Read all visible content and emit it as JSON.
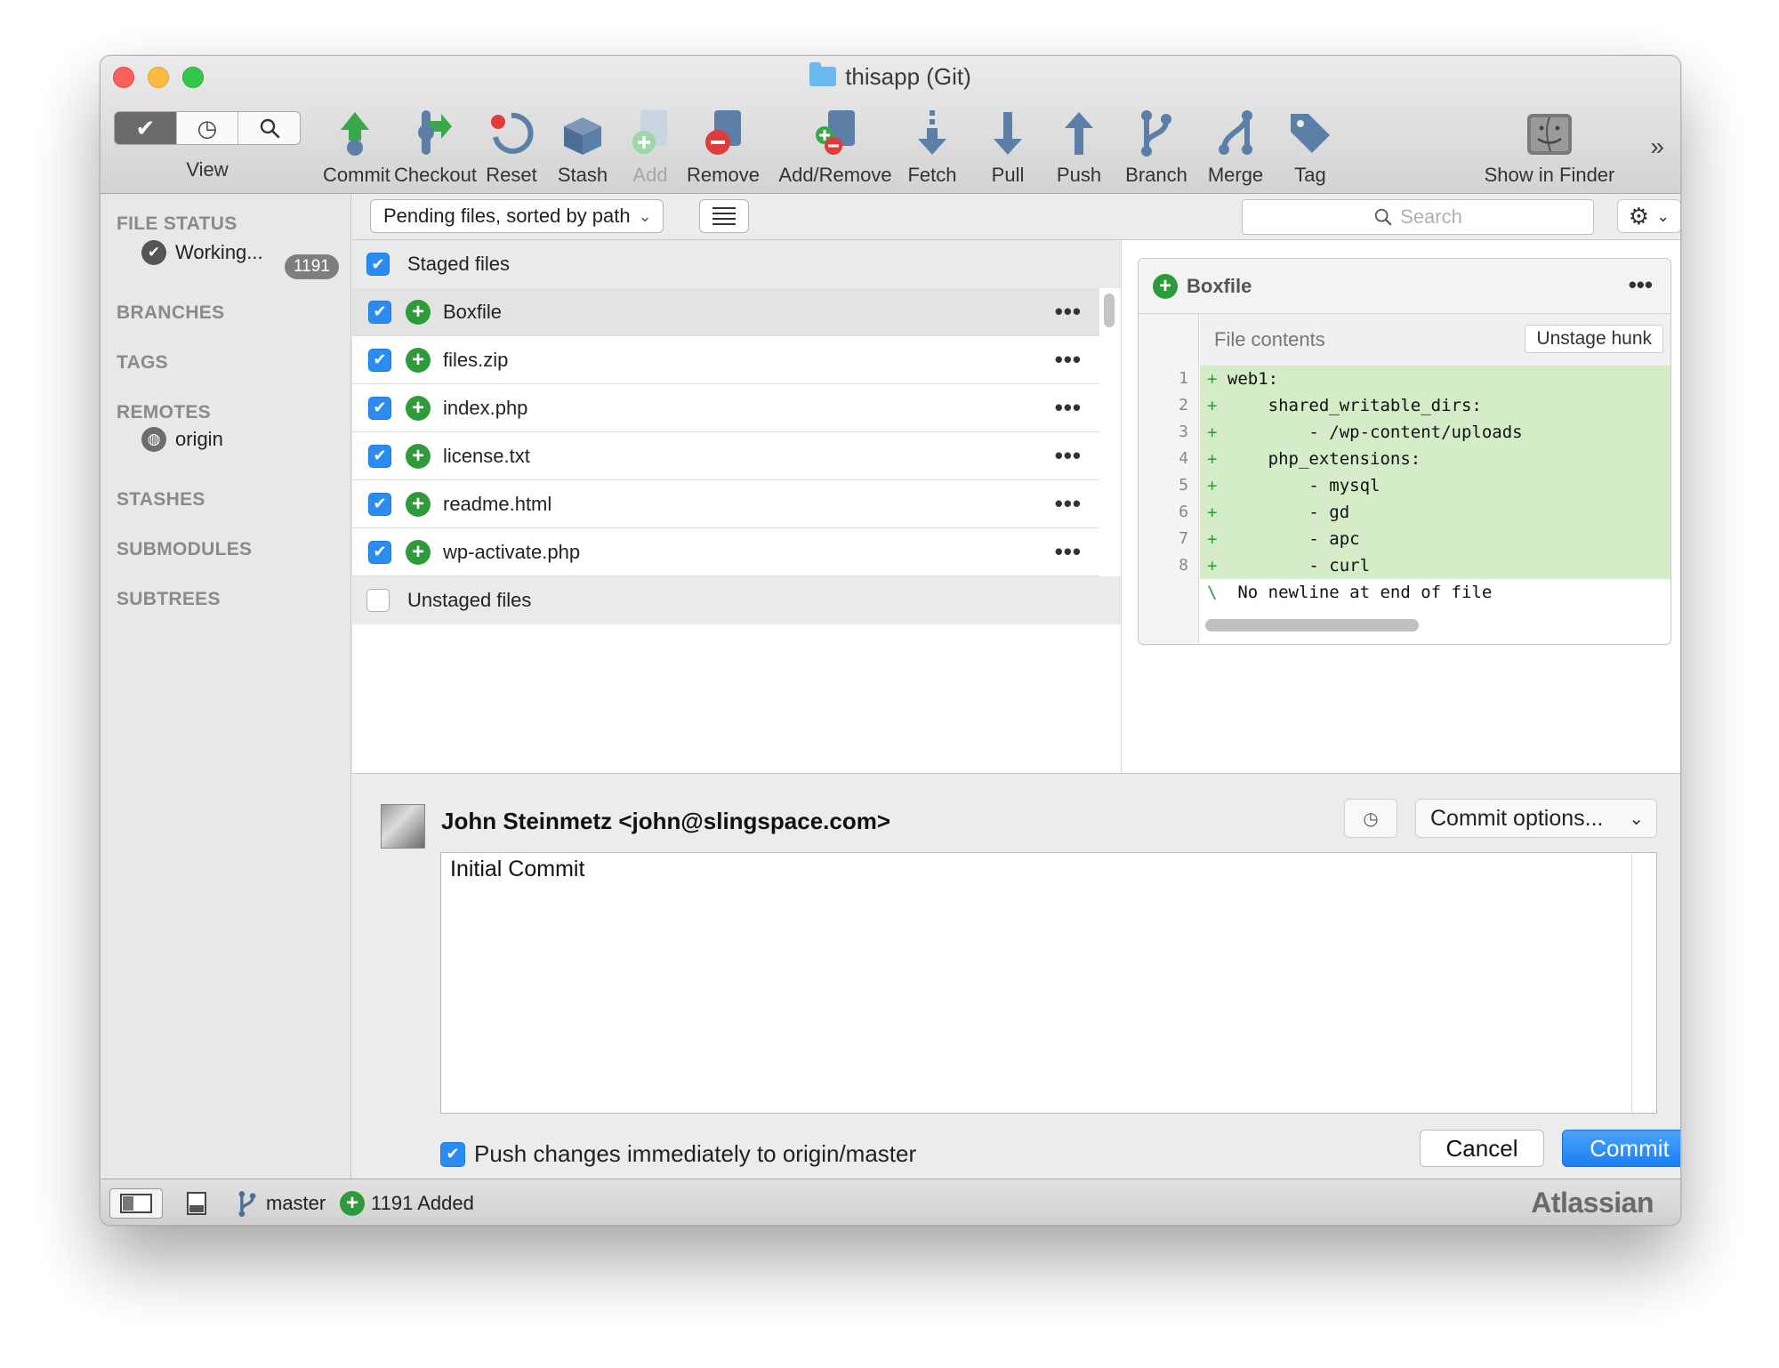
{
  "window": {
    "title": "thisapp (Git)"
  },
  "toolbar": {
    "view_label": "View",
    "items": [
      {
        "label": "Commit",
        "icon": "commit-icon"
      },
      {
        "label": "Checkout",
        "icon": "checkout-icon"
      },
      {
        "label": "Reset",
        "icon": "reset-icon"
      },
      {
        "label": "Stash",
        "icon": "stash-icon"
      },
      {
        "label": "Add",
        "icon": "add-icon"
      },
      {
        "label": "Remove",
        "icon": "remove-icon"
      },
      {
        "label": "Add/Remove",
        "icon": "add-remove-icon"
      },
      {
        "label": "Fetch",
        "icon": "fetch-icon"
      },
      {
        "label": "Pull",
        "icon": "pull-icon"
      },
      {
        "label": "Push",
        "icon": "push-icon"
      },
      {
        "label": "Branch",
        "icon": "branch-icon"
      },
      {
        "label": "Merge",
        "icon": "merge-icon"
      },
      {
        "label": "Tag",
        "icon": "tag-icon"
      },
      {
        "label": "Show in Finder",
        "icon": "finder-icon"
      }
    ],
    "more": "»"
  },
  "sidebar": {
    "file_status": "FILE STATUS",
    "working_copy": "Working...",
    "working_count": "1191",
    "branches": "BRANCHES",
    "tags": "TAGS",
    "remotes": "REMOTES",
    "remote_origin": "origin",
    "stashes": "STASHES",
    "submodules": "SUBMODULES",
    "subtrees": "SUBTREES"
  },
  "filter": {
    "sort_label": "Pending files, sorted by path",
    "search_placeholder": "Search"
  },
  "files": {
    "staged_label": "Staged files",
    "unstaged_label": "Unstaged files",
    "staged": [
      {
        "name": "Boxfile"
      },
      {
        "name": "files.zip"
      },
      {
        "name": "index.php"
      },
      {
        "name": "license.txt"
      },
      {
        "name": "readme.html"
      },
      {
        "name": "wp-activate.php"
      }
    ]
  },
  "diff": {
    "file": "Boxfile",
    "hunk_title": "File contents",
    "hunk_button": "Unstage hunk",
    "lines": [
      {
        "n": "1",
        "text": "web1:"
      },
      {
        "n": "2",
        "text": "    shared_writable_dirs:"
      },
      {
        "n": "3",
        "text": "        - /wp-content/uploads"
      },
      {
        "n": "4",
        "text": "    php_extensions:"
      },
      {
        "n": "5",
        "text": "        - mysql"
      },
      {
        "n": "6",
        "text": "        - gd"
      },
      {
        "n": "7",
        "text": "        - apc"
      },
      {
        "n": "8",
        "text": "        - curl"
      }
    ],
    "no_newline": "No newline at end of file"
  },
  "commit": {
    "author": "John Steinmetz <john@slingspace.com>",
    "options_label": "Commit options...",
    "message": "Initial Commit",
    "push_label": "Push changes immediately to origin/master",
    "cancel": "Cancel",
    "commit": "Commit"
  },
  "statusbar": {
    "branch": "master",
    "summary": "1191 Added",
    "brand": "Atlassian"
  },
  "colors": {
    "accent": "#2a8cf0",
    "added": "#2e9a3a",
    "diff_added_bg": "#d5ecc8"
  }
}
